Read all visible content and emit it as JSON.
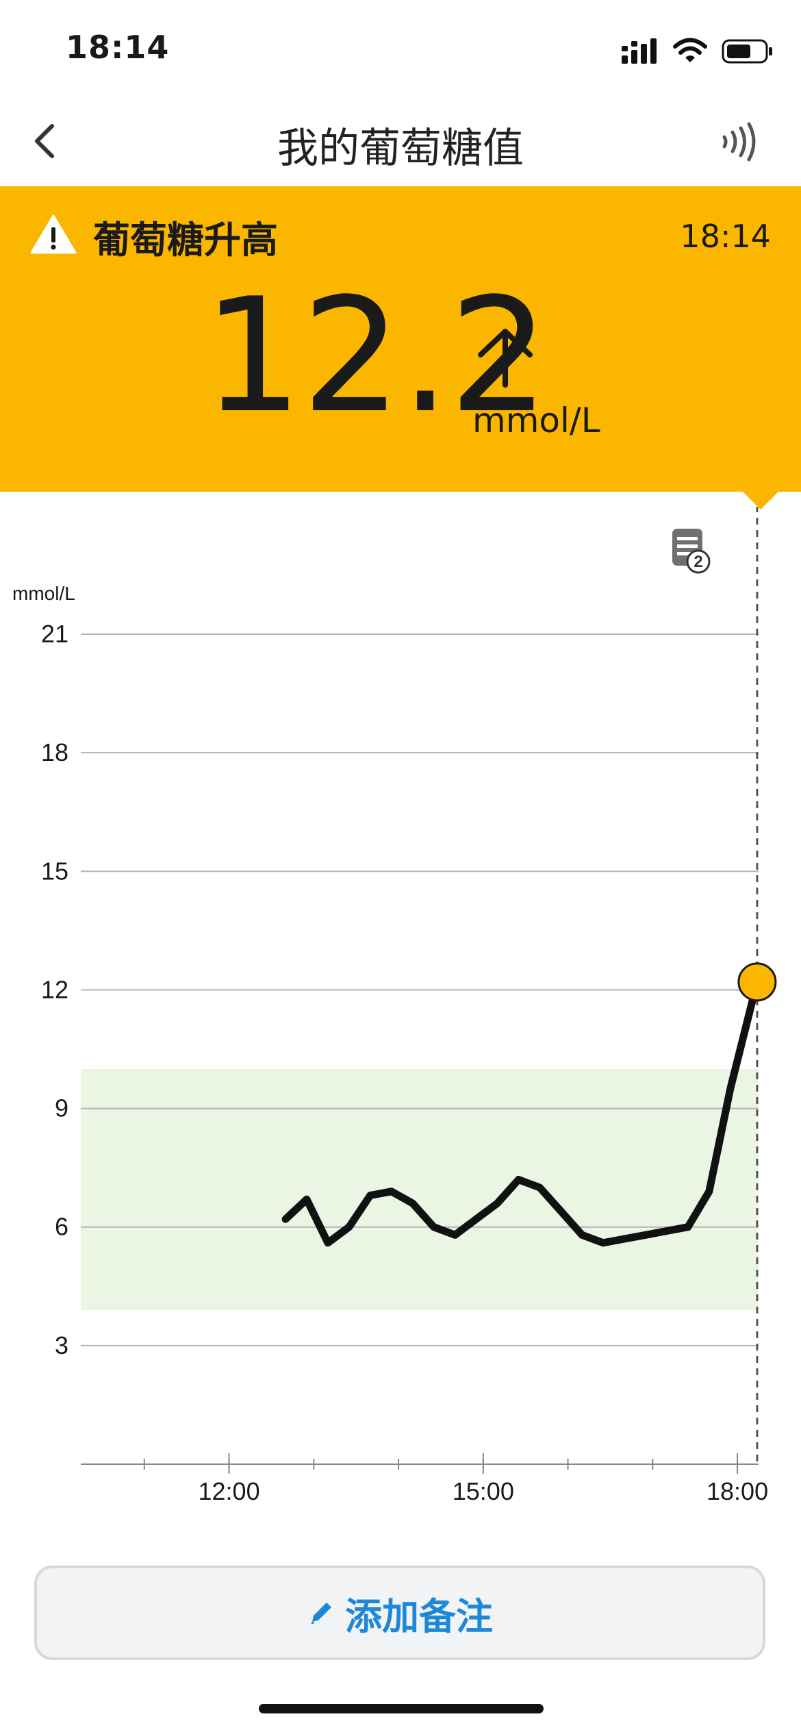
{
  "status_bar": {
    "time": "18:14"
  },
  "nav": {
    "title": "我的葡萄糖值"
  },
  "alert": {
    "title": "葡萄糖升高",
    "time": "18:14",
    "value": "12.2",
    "unit": "mmol/L",
    "trend": "rising",
    "color": "#fbb600"
  },
  "notes": {
    "count": "2"
  },
  "chart_data": {
    "type": "line",
    "ylabel": "mmol/L",
    "y_ticks": [
      "21",
      "18",
      "15",
      "12",
      "9",
      "6",
      "3"
    ],
    "x_ticks": [
      "12:00",
      "15:00",
      "18:00"
    ],
    "ylim": [
      0,
      21
    ],
    "xlim": [
      "10:15",
      "18:15"
    ],
    "target_range": [
      3.9,
      10.0
    ],
    "target_range_color": "#ebf5e4",
    "line_color": "#111111",
    "current_marker_color": "#fbb600",
    "series": [
      {
        "x": [
          "12:40",
          "12:55",
          "13:10",
          "13:25",
          "13:40",
          "13:55",
          "14:10",
          "14:25",
          "14:40",
          "14:55",
          "15:10",
          "15:25",
          "15:40",
          "15:55",
          "16:10",
          "16:25",
          "16:40",
          "16:55",
          "17:10",
          "17:25",
          "17:40",
          "17:55",
          "18:14"
        ],
        "values": [
          6.2,
          6.7,
          5.6,
          6.0,
          6.8,
          6.9,
          6.6,
          6.0,
          5.8,
          6.2,
          6.6,
          7.2,
          7.0,
          6.4,
          5.8,
          5.6,
          5.7,
          5.8,
          5.9,
          6.0,
          6.9,
          9.5,
          12.2
        ]
      }
    ]
  },
  "actions": {
    "add_note": "添加备注"
  }
}
